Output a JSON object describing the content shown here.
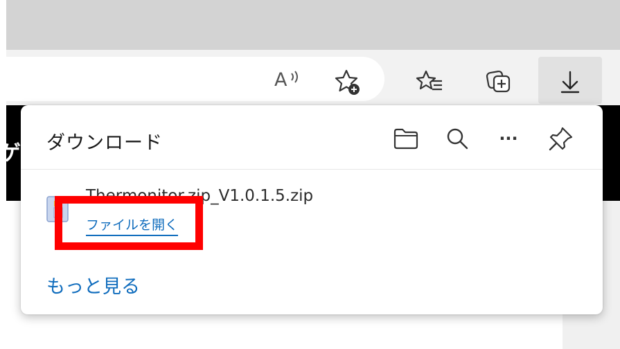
{
  "toolbar": {
    "read_aloud_glyph": "A",
    "icons": [
      "read-aloud-icon",
      "add-favorite-icon",
      "favorites-icon",
      "collections-icon",
      "downloads-icon"
    ]
  },
  "page": {
    "fragment_text": "ゲ"
  },
  "downloads_panel": {
    "title": "ダウンロード",
    "header_icons": [
      "folder-icon",
      "search-icon",
      "more-icon",
      "pin-icon"
    ],
    "more_glyph": "···",
    "items": [
      {
        "file_name": "Thermonitor.zip_V1.0.1.5.zip",
        "open_label": "ファイルを開く"
      }
    ],
    "see_more_label": "もっと見る"
  },
  "colors": {
    "link": "#0f6cbd",
    "highlight_box": "#ff0000",
    "tabstrip": "#d3d3d3",
    "toolbar": "#f2f2f2"
  }
}
